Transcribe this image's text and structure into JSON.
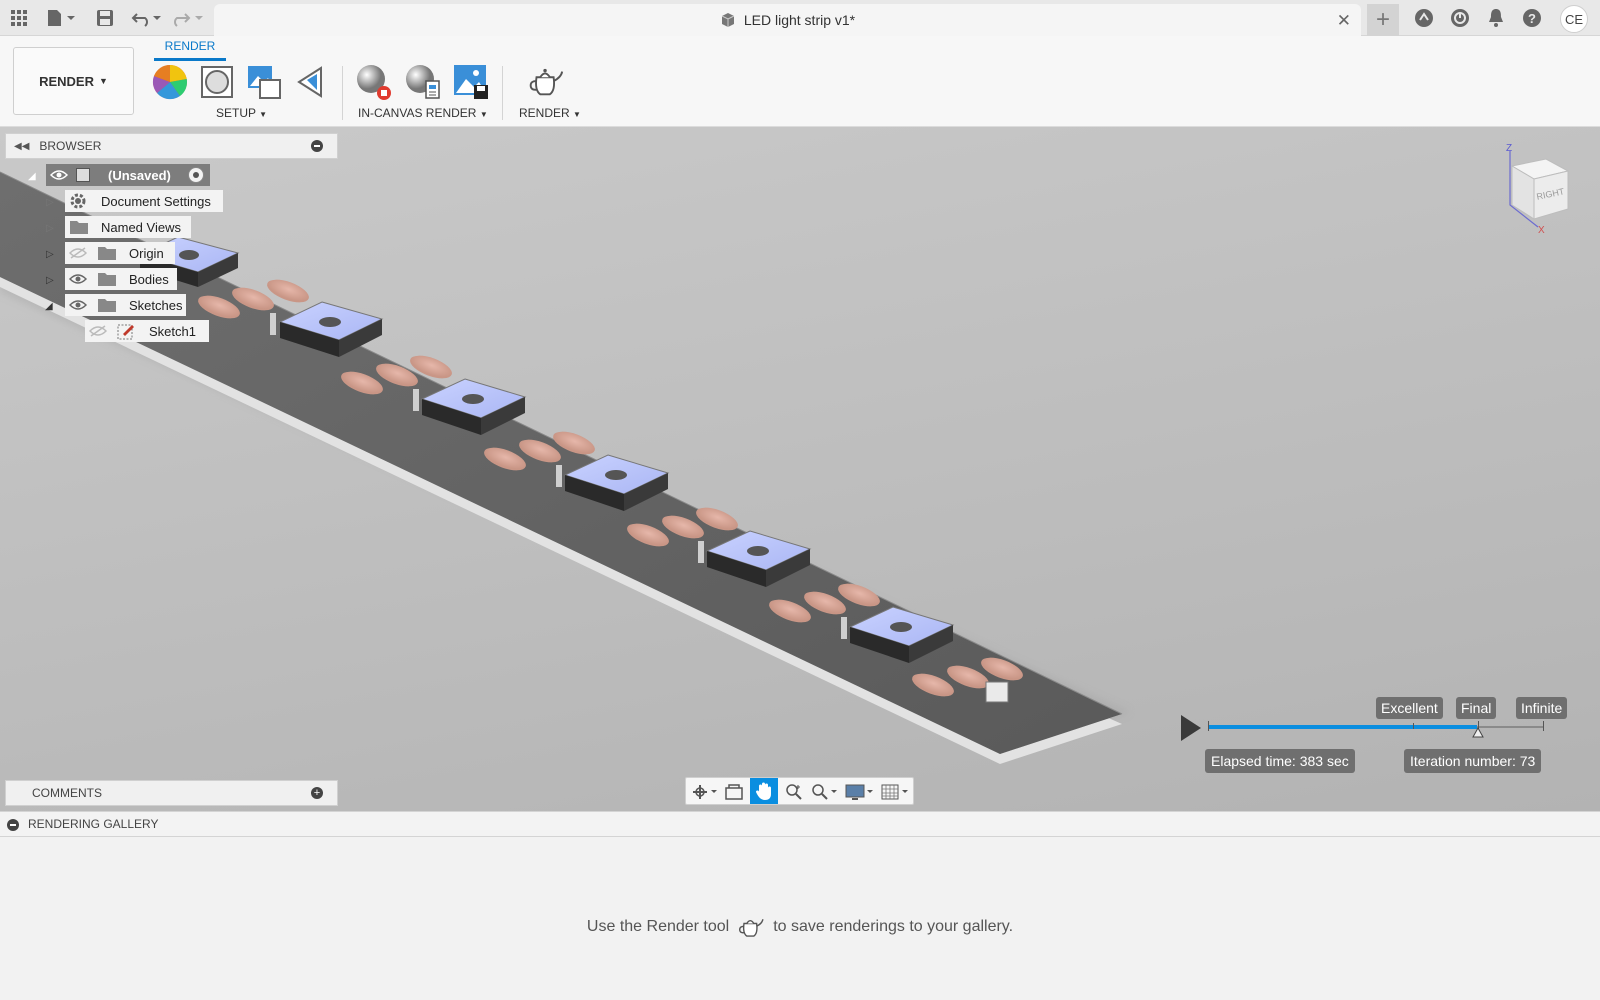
{
  "document": {
    "title": "LED light strip v1*"
  },
  "user": {
    "initials": "CE"
  },
  "ribbon": {
    "workspace_label": "RENDER",
    "active_tab": "RENDER",
    "groups": {
      "setup": "SETUP",
      "in_canvas": "IN-CANVAS RENDER",
      "render": "RENDER"
    }
  },
  "browser": {
    "title": "BROWSER",
    "root_label": "(Unsaved)",
    "items": [
      {
        "label": "Document Settings",
        "icon": "gear-icon"
      },
      {
        "label": "Named Views",
        "icon": "folder-icon"
      },
      {
        "label": "Origin",
        "icon": "folder-icon",
        "visibility": "hidden"
      },
      {
        "label": "Bodies",
        "icon": "folder-icon",
        "visibility": "visible"
      },
      {
        "label": "Sketches",
        "icon": "folder-icon",
        "visibility": "visible"
      },
      {
        "label": "Sketch1",
        "icon": "sketch-icon",
        "visibility": "hidden"
      }
    ]
  },
  "comments": {
    "title": "COMMENTS"
  },
  "render_progress": {
    "quality_levels": [
      "Excellent",
      "Final",
      "Infinite"
    ],
    "progress_fraction": 0.8,
    "elapsed": "Elapsed time: 383 sec",
    "iteration": "Iteration number: 73"
  },
  "viewcube": {
    "face_right": "RIGHT",
    "axes": [
      "Z",
      "X"
    ]
  },
  "gallery": {
    "title": "RENDERING GALLERY",
    "message_before": "Use the Render tool",
    "message_after": "to save renderings to your gallery."
  },
  "colors": {
    "accent": "#0a79c9",
    "progress": "#0a8ee0",
    "badge": "#6f6f6f",
    "led_top": "#b8c4ff",
    "pad": "#d9a898"
  }
}
